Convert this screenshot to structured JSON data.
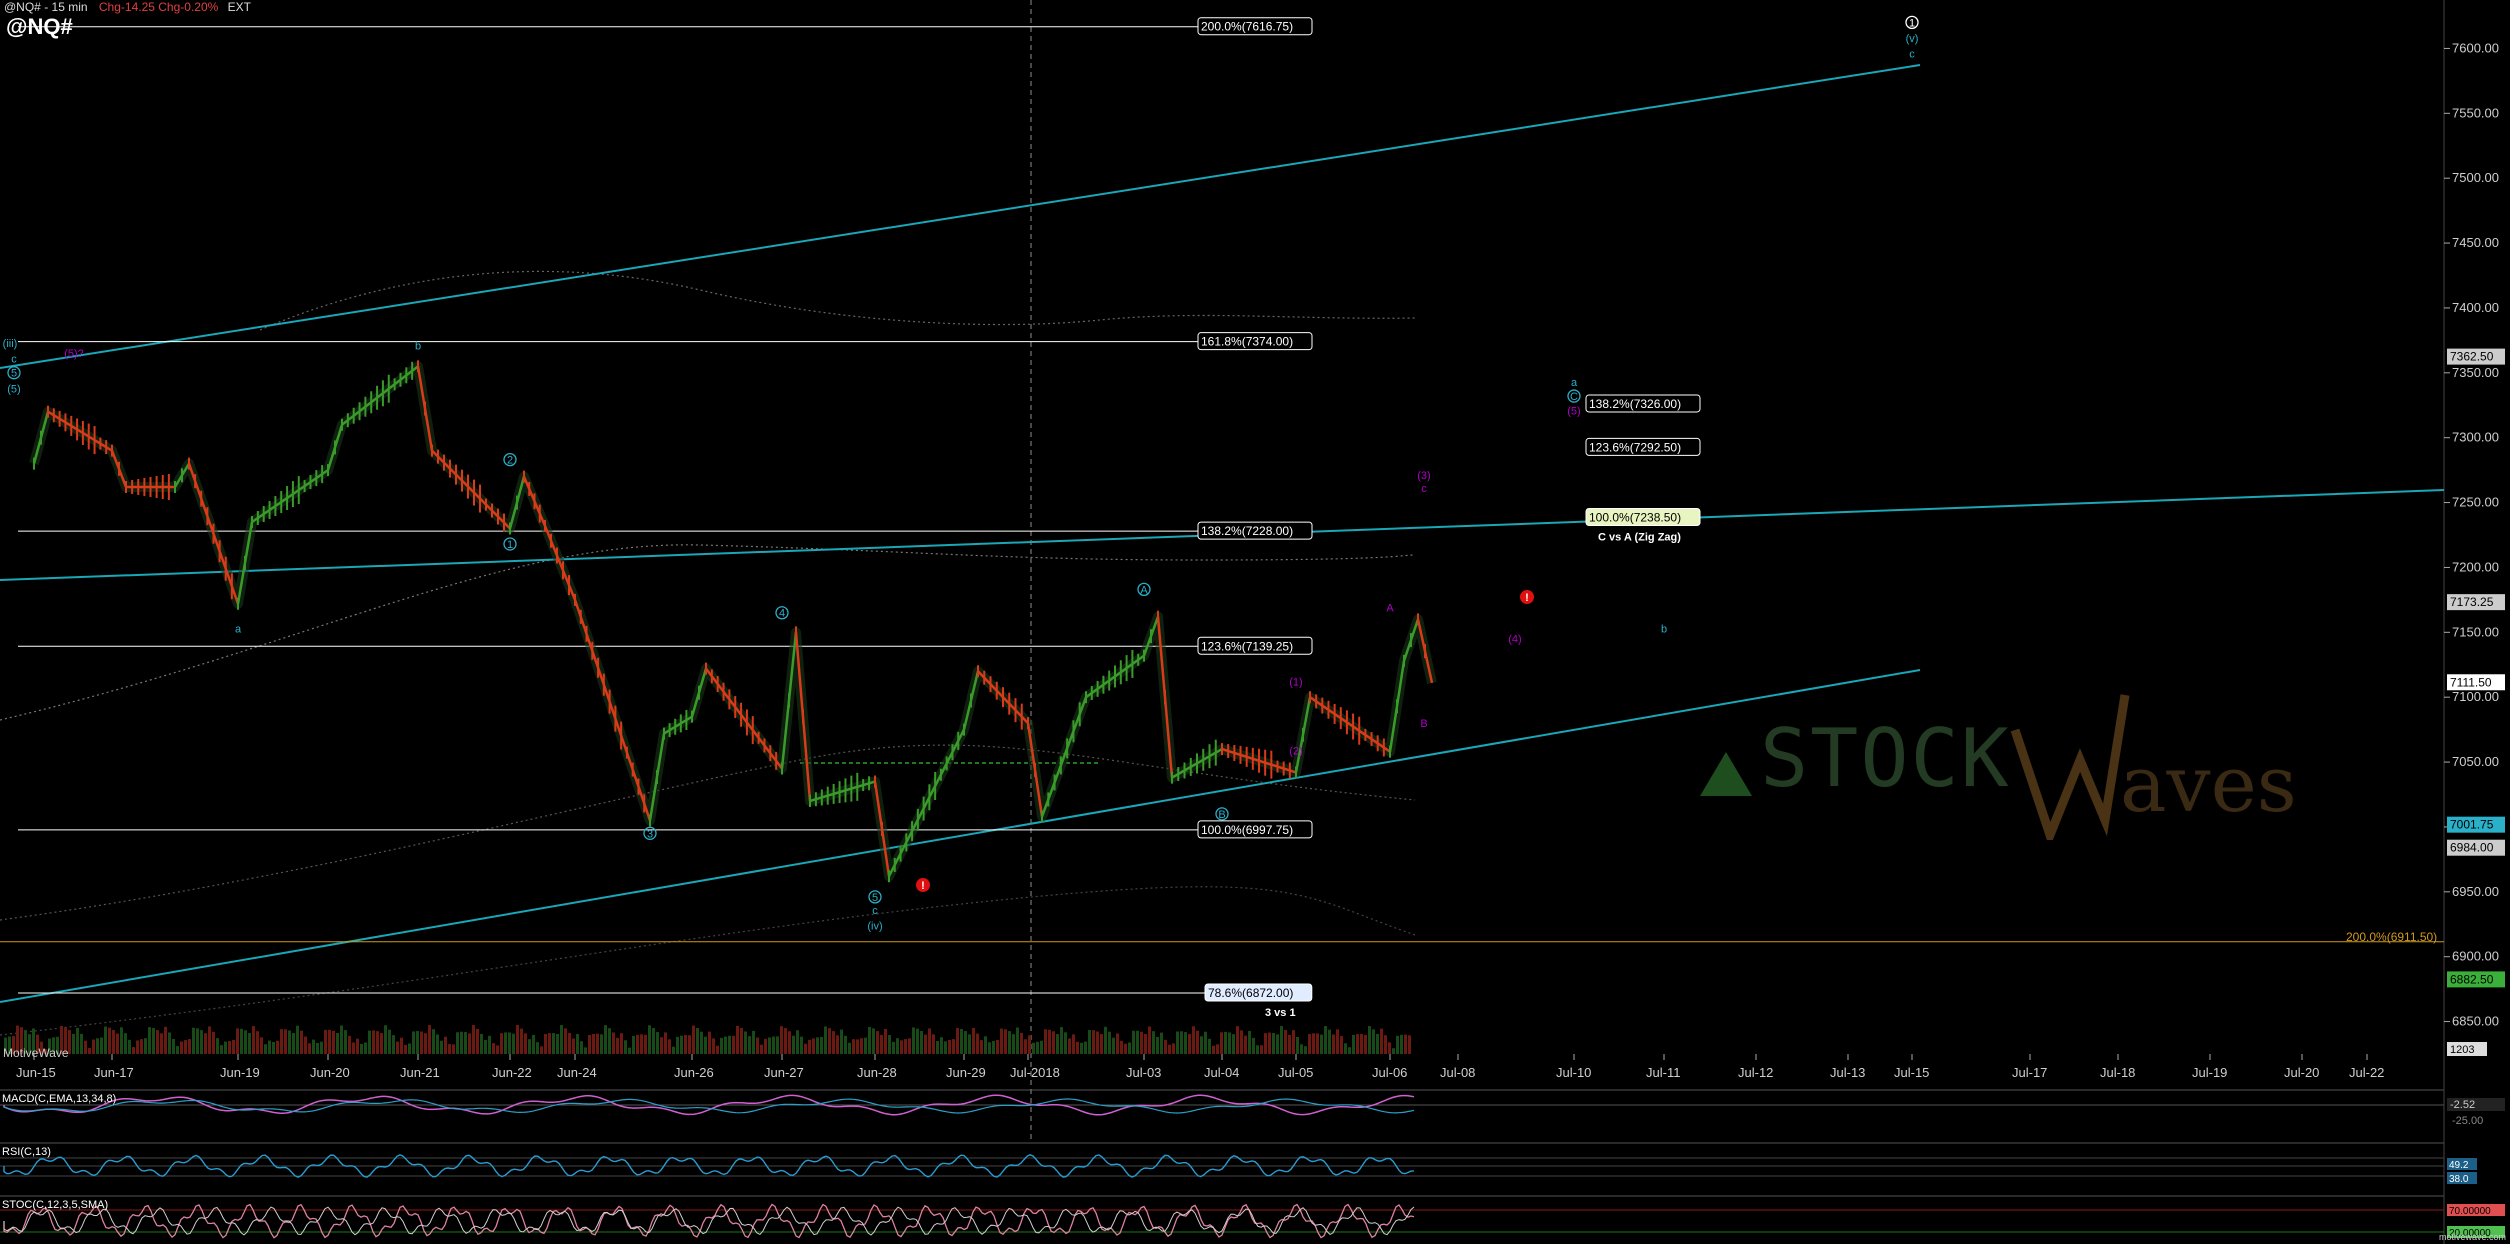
{
  "header": {
    "symbol_line": "@NQ# - 15 min",
    "change_text": "Chg-14.25  Chg-0.20%",
    "ext": "EXT",
    "symbol": "@NQ#"
  },
  "watermark": {
    "text": "STOCK",
    "suffix": "aves"
  },
  "motive_label": "MotiveWave",
  "credit": "motivewave.com",
  "colors": {
    "background": "#000000",
    "trendline": "#1aa7b8",
    "wave_cyan": "#2ab0c8",
    "wave_magenta": "#b000c8",
    "fib_line": "#ffffff",
    "orange_level": "#d09a20",
    "candle_up": "#3a9a2a",
    "candle_down": "#d83a1a",
    "macd": "#d060d0",
    "rsi": "#2a9bd0",
    "stoch": "#e080a0"
  },
  "chart_data": {
    "type": "line",
    "title": "@NQ# - 15 min",
    "xlabel": "",
    "ylabel": "",
    "ylim": [
      6825,
      7625
    ],
    "x_ticks": [
      "Jun-15",
      "Jun-17",
      "Jun-19",
      "Jun-20",
      "Jun-21",
      "Jun-22",
      "Jun-24",
      "Jun-26",
      "Jun-27",
      "Jun-28",
      "Jun-29",
      "Jul-2018",
      "Jul-03",
      "Jul-04",
      "Jul-05",
      "Jul-06",
      "Jul-08",
      "Jul-10",
      "Jul-11",
      "Jul-12",
      "Jul-13",
      "Jul-15",
      "Jul-17",
      "Jul-18",
      "Jul-19",
      "Jul-20",
      "Jul-22"
    ],
    "y_ticks": [
      6850,
      6900,
      6950,
      7000,
      7050,
      7100,
      7150,
      7200,
      7250,
      7300,
      7350,
      7400,
      7450,
      7500,
      7550,
      7600
    ],
    "y_tick_labels": [
      "6850.00",
      "6900.00",
      "6950.00",
      "7000.00",
      "7050.00",
      "7100.00",
      "7150.00",
      "7200.00",
      "7250.00",
      "7300.00",
      "7350.00",
      "7400.00",
      "7450.00",
      "7500.00",
      "7550.00",
      "7600.00"
    ],
    "price_points": [
      {
        "x": "Jun-15",
        "y": 7280
      },
      {
        "x": "Jun-15",
        "y": 7320
      },
      {
        "x": "Jun-17",
        "y": 7290
      },
      {
        "x": "Jun-17",
        "y": 7262
      },
      {
        "x": "Jun-18",
        "y": 7262
      },
      {
        "x": "Jun-18",
        "y": 7280
      },
      {
        "x": "Jun-19",
        "y": 7172
      },
      {
        "x": "Jun-19",
        "y": 7235
      },
      {
        "x": "Jun-20",
        "y": 7275
      },
      {
        "x": "Jun-20",
        "y": 7310
      },
      {
        "x": "Jun-21",
        "y": 7355
      },
      {
        "x": "Jun-21",
        "y": 7290
      },
      {
        "x": "Jun-22",
        "y": 7230
      },
      {
        "x": "Jun-22",
        "y": 7270
      },
      {
        "x": "Jun-23",
        "y": 7232
      },
      {
        "x": "Jun-24",
        "y": 7175
      },
      {
        "x": "Jun-25",
        "y": 7005
      },
      {
        "x": "Jun-25",
        "y": 7072
      },
      {
        "x": "Jun-26",
        "y": 7085
      },
      {
        "x": "Jun-26",
        "y": 7122
      },
      {
        "x": "Jun-27",
        "y": 7045
      },
      {
        "x": "Jun-27",
        "y": 7150
      },
      {
        "x": "Jun-27",
        "y": 7020
      },
      {
        "x": "Jun-28",
        "y": 7035
      },
      {
        "x": "Jun-28",
        "y": 6962
      },
      {
        "x": "Jun-29",
        "y": 7075
      },
      {
        "x": "Jun-29",
        "y": 7120
      },
      {
        "x": "Jul-2018",
        "y": 7080
      },
      {
        "x": "Jul-2018",
        "y": 7008
      },
      {
        "x": "Jul-02",
        "y": 7100
      },
      {
        "x": "Jul-03",
        "y": 7132
      },
      {
        "x": "Jul-03",
        "y": 7162
      },
      {
        "x": "Jul-03",
        "y": 7038
      },
      {
        "x": "Jul-04",
        "y": 7060
      },
      {
        "x": "Jul-05",
        "y": 7042
      },
      {
        "x": "Jul-05",
        "y": 7100
      },
      {
        "x": "Jul-06",
        "y": 7058
      },
      {
        "x": "Jul-06",
        "y": 7128
      },
      {
        "x": "Jul-06",
        "y": 7160
      },
      {
        "x": "Jul-06",
        "y": 7111
      }
    ],
    "fib_levels": [
      {
        "label": "200.0%(7616.75)",
        "value": 7616.75
      },
      {
        "label": "161.8%(7374.00)",
        "value": 7374.0
      },
      {
        "label": "138.2%(7228.00)",
        "value": 7228.0
      },
      {
        "label": "123.6%(7139.25)",
        "value": 7139.25
      },
      {
        "label": "100.0%(6997.75)",
        "value": 6997.75
      },
      {
        "label": "78.6%(6872.00)",
        "value": 6872.0,
        "note": "3 vs 1"
      },
      {
        "label": "138.2%(7326.00)",
        "value": 7326.0
      },
      {
        "label": "123.6%(7292.50)",
        "value": 7292.5
      },
      {
        "label": "100.0%(7238.50)",
        "value": 7238.5,
        "note": "C vs A (Zig Zag)"
      },
      {
        "label": "200.0%(6911.50)",
        "value": 6911.5
      }
    ],
    "price_markers": [
      {
        "label": "7362.50",
        "value": 7362.5,
        "color": "#cccccc"
      },
      {
        "label": "7173.25",
        "value": 7173.25,
        "color": "#cccccc"
      },
      {
        "label": "7111.50",
        "value": 7111.5,
        "color": "#ffffff"
      },
      {
        "label": "7001.75",
        "value": 7001.75,
        "color": "#2ab0c8"
      },
      {
        "label": "6984.00",
        "value": 6984.0,
        "color": "#cccccc"
      },
      {
        "label": "6882.50",
        "value": 6882.5,
        "color": "#3ab03a"
      }
    ],
    "wave_labels": [
      {
        "text": "(iii)",
        "x": "Jun-15",
        "y": 7370,
        "color": "cyan"
      },
      {
        "text": "c",
        "x": "Jun-15",
        "y": 7358,
        "color": "cyan"
      },
      {
        "text": "5",
        "x": "Jun-15",
        "y": 7347,
        "color": "cyan"
      },
      {
        "text": "(5)",
        "x": "Jun-15",
        "y": 7335,
        "color": "cyan"
      },
      {
        "text": "(5)?",
        "x": "Jun-15",
        "y": 7362,
        "color": "magenta"
      },
      {
        "text": "b",
        "x": "Jun-21",
        "y": 7368,
        "color": "cyan"
      },
      {
        "text": "2",
        "x": "Jun-22",
        "y": 7280,
        "color": "cyan"
      },
      {
        "text": "1",
        "x": "Jun-22",
        "y": 7215,
        "color": "cyan"
      },
      {
        "text": "a",
        "x": "Jun-19",
        "y": 7150,
        "color": "cyan"
      },
      {
        "text": "4",
        "x": "Jun-27",
        "y": 7162,
        "color": "cyan"
      },
      {
        "text": "3",
        "x": "Jun-25",
        "y": 6992,
        "color": "cyan"
      },
      {
        "text": "5",
        "x": "Jun-28",
        "y": 6943,
        "color": "cyan"
      },
      {
        "text": "c",
        "x": "Jun-28",
        "y": 6933,
        "color": "cyan"
      },
      {
        "text": "(iv)",
        "x": "Jun-28",
        "y": 6921,
        "color": "cyan"
      },
      {
        "text": "A",
        "x": "Jul-03",
        "y": 7180,
        "color": "cyan"
      },
      {
        "text": "B",
        "x": "Jul-04",
        "y": 7007,
        "color": "cyan"
      },
      {
        "text": "A",
        "x": "Jul-06",
        "y": 7166,
        "color": "magenta"
      },
      {
        "text": "(1)",
        "x": "Jul-05",
        "y": 7109,
        "color": "magenta"
      },
      {
        "text": "(2)",
        "x": "Jul-05",
        "y": 7056,
        "color": "magenta"
      },
      {
        "text": "B",
        "x": "Jul-07",
        "y": 7077,
        "color": "magenta"
      },
      {
        "text": "(4)",
        "x": "Jul-09",
        "y": 7142,
        "color": "magenta"
      },
      {
        "text": "(3)",
        "x": "Jul-07",
        "y": 7268,
        "color": "magenta"
      },
      {
        "text": "c",
        "x": "Jul-07",
        "y": 7258,
        "color": "magenta"
      },
      {
        "text": "a",
        "x": "Jul-10",
        "y": 7340,
        "color": "cyan"
      },
      {
        "text": "C",
        "x": "Jul-10",
        "y": 7329,
        "color": "cyan"
      },
      {
        "text": "(5)",
        "x": "Jul-10",
        "y": 7318,
        "color": "magenta"
      },
      {
        "text": "b",
        "x": "Jul-11",
        "y": 7150,
        "color": "cyan"
      },
      {
        "text": "1",
        "x": "Jul-15",
        "y": 7617,
        "color": "white"
      },
      {
        "text": "(v)",
        "x": "Jul-15",
        "y": 7605,
        "color": "cyan"
      },
      {
        "text": "c",
        "x": "Jul-15",
        "y": 7593,
        "color": "cyan"
      }
    ]
  },
  "indicators": {
    "macd": {
      "label": "MACD(C,EMA,13,34,8)",
      "values": [
        "-2.52",
        "-25.00"
      ]
    },
    "rsi": {
      "label": "RSI(C,13)",
      "values": [
        "49.2",
        "38.0"
      ]
    },
    "stoch": {
      "label": "STOC(C,12,3,5,SMA)",
      "values": [
        "70.00000",
        "20.00000"
      ]
    },
    "volume_tag": "1203"
  }
}
